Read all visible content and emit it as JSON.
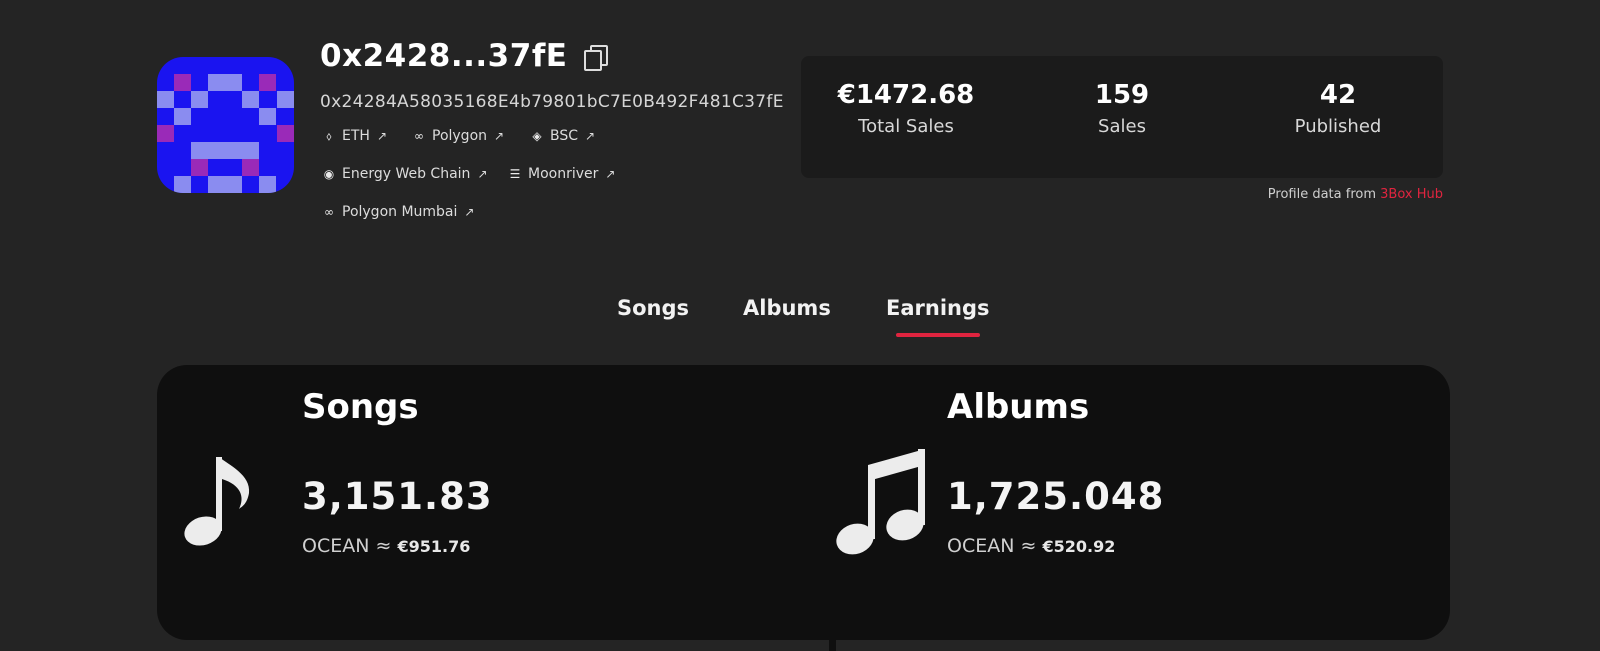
{
  "profile": {
    "short_address": "0x2428...37fE",
    "full_address": "0x24284A58035168E4b79801bC7E0B492F481C37fE"
  },
  "networks": [
    {
      "label": "ETH",
      "icon": "eth-icon"
    },
    {
      "label": "Polygon",
      "icon": "polygon-icon"
    },
    {
      "label": "BSC",
      "icon": "bsc-icon"
    },
    {
      "label": "Energy Web Chain",
      "icon": "energy-web-icon"
    },
    {
      "label": "Moonriver",
      "icon": "moonriver-icon"
    },
    {
      "label": "Polygon Mumbai",
      "icon": "polygon-icon"
    }
  ],
  "stats": {
    "total_sales_value": "€1472.68",
    "total_sales_label": "Total Sales",
    "sales_value": "159",
    "sales_label": "Sales",
    "published_value": "42",
    "published_label": "Published"
  },
  "profile_source": {
    "prefix": "Profile data from",
    "link": "3Box Hub"
  },
  "tabs": [
    {
      "label": "Songs",
      "active": false
    },
    {
      "label": "Albums",
      "active": false
    },
    {
      "label": "Earnings",
      "active": true
    }
  ],
  "earnings": {
    "songs": {
      "title": "Songs",
      "value": "3,151.83",
      "unit": "OCEAN",
      "approx": "≈",
      "fiat": "€951.76",
      "icon": "music-note-icon"
    },
    "albums": {
      "title": "Albums",
      "value": "1,725.048",
      "unit": "OCEAN",
      "approx": "≈",
      "fiat": "€520.92",
      "icon": "music-notes-icon"
    }
  },
  "colors": {
    "background": "#242424",
    "panel": "#0f0f0f",
    "stats_panel": "#1b1b1b",
    "accent": "#e0243f",
    "avatar_blue": "#1a14f0",
    "avatar_light": "#8a8cf0",
    "avatar_purple": "#9a2ab8"
  }
}
